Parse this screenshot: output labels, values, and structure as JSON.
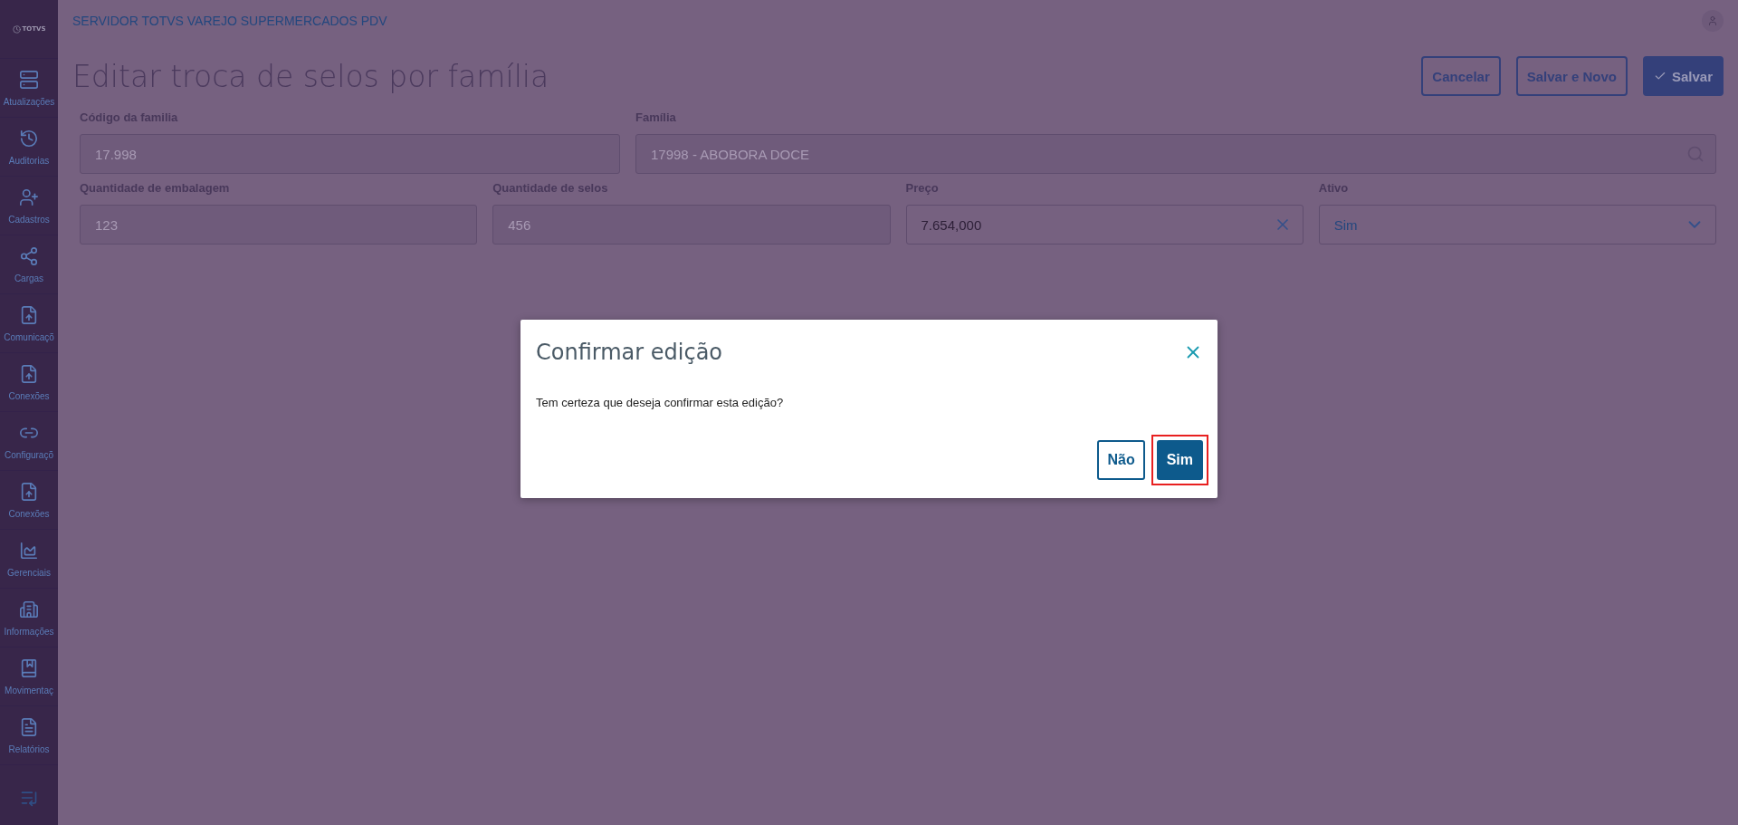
{
  "app": {
    "logo": "TOTVS",
    "header_title": "SERVIDOR TOTVS VAREJO SUPERMERCADOS PDV"
  },
  "sidebar": {
    "items": [
      {
        "label": "Atualizações"
      },
      {
        "label": "Auditorias"
      },
      {
        "label": "Cadastros"
      },
      {
        "label": "Cargas"
      },
      {
        "label": "Comunicaçõ"
      },
      {
        "label": "Conexões"
      },
      {
        "label": "Configuraçõ"
      },
      {
        "label": "Conexões"
      },
      {
        "label": "Gerenciais"
      },
      {
        "label": "Informações"
      },
      {
        "label": "Movimentaç"
      },
      {
        "label": "Relatórios"
      }
    ]
  },
  "page": {
    "title": "Editar troca de selos por família",
    "actions": [
      {
        "label": "Cancelar",
        "kind": "outline"
      },
      {
        "label": "Salvar e Novo",
        "kind": "outline"
      },
      {
        "label": "Salvar",
        "kind": "primary"
      }
    ]
  },
  "form": {
    "rows": [
      [
        {
          "label": "Código da familia",
          "value": "17.998",
          "disabled": true,
          "kind": "text"
        },
        {
          "label": "Família",
          "value": "17998 - ABOBORA DOCE",
          "disabled": true,
          "kind": "lookup"
        }
      ],
      [
        {
          "label": "Quantidade de embalagem",
          "value": "123",
          "disabled": true,
          "kind": "text"
        },
        {
          "label": "Quantidade de selos",
          "value": "456",
          "disabled": true,
          "kind": "text"
        },
        {
          "label": "Preço",
          "value": "7.654,000",
          "disabled": false,
          "kind": "clearable"
        },
        {
          "label": "Ativo",
          "value": "Sim",
          "disabled": false,
          "kind": "select"
        }
      ]
    ]
  },
  "dialog": {
    "title": "Confirmar edição",
    "message": "Tem certeza que deseja confirmar esta edição?",
    "buttons": [
      {
        "label": "Não",
        "kind": "outline",
        "highlighted": false
      },
      {
        "label": "Sim",
        "kind": "primary",
        "highlighted": true
      }
    ]
  }
}
